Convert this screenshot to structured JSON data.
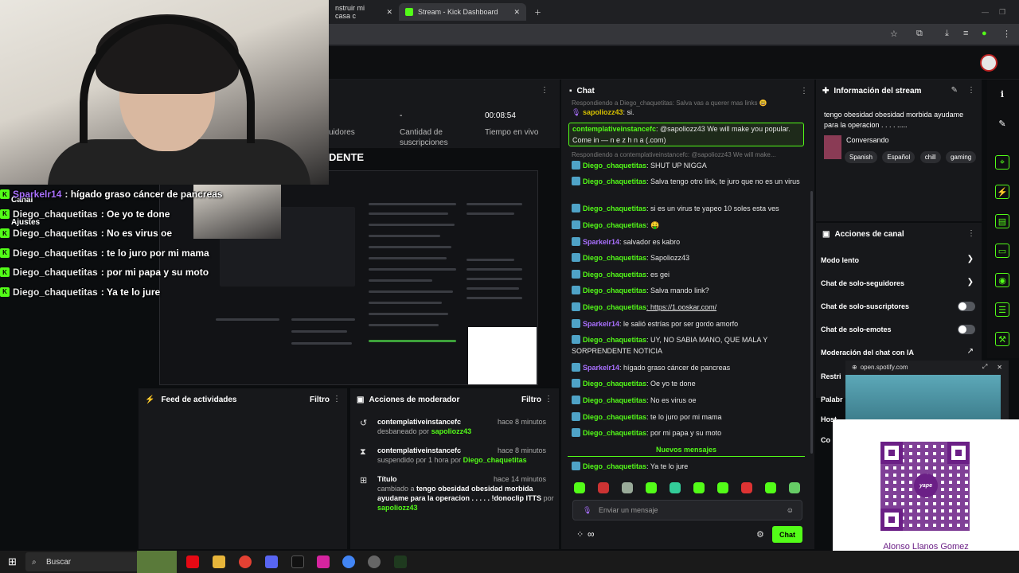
{
  "browser": {
    "tabs": [
      {
        "label": "nstruir mi casa c"
      },
      {
        "label": "Stream - Kick Dashboard"
      }
    ]
  },
  "stats": [
    {
      "value": "",
      "label": "uidores"
    },
    {
      "value": "-",
      "label": "Cantidad de suscripciones"
    },
    {
      "value": "00:08:54",
      "label": "Tiempo en vivo"
    }
  ],
  "stream_title_fragment": "DENTE",
  "overlay": {
    "canal": "Canal",
    "ajustes": "Ajustes",
    "messages": [
      {
        "user": "Sparkelr14",
        "text": ": hígado graso cáncer de pancreas",
        "color": "purple"
      },
      {
        "user": "Diego_chaquetitas",
        "text": ": Oe yo te done",
        "color": "white"
      },
      {
        "user": "Diego_chaquetitas",
        "text": ": No es virus oe",
        "color": "white"
      },
      {
        "user": "Diego_chaquetitas",
        "text": ": te lo juro por mi mama",
        "color": "white"
      },
      {
        "user": "Diego_chaquetitas",
        "text": ": por mi papa y su moto",
        "color": "white"
      },
      {
        "user": "Diego_chaquetitas",
        "text": ": Ya te lo jure",
        "color": "white"
      }
    ]
  },
  "activity_feed": {
    "title": "Feed de actividades",
    "filter": "Filtro"
  },
  "mod_actions": {
    "title": "Acciones de moderador",
    "filter": "Filtro",
    "items": [
      {
        "icon": "undo-icon",
        "name": "contemplativeinstancefc",
        "time": "hace 8 minutos",
        "action": "desbaneado por",
        "by": "sapoliozz43"
      },
      {
        "icon": "hourglass-icon",
        "name": "contemplativeinstancefc",
        "time": "hace 8 minutos",
        "action": "suspendido por 1 hora por",
        "by": "Diego_chaquetitas"
      },
      {
        "icon": "title-icon",
        "name": "Título",
        "time": "hace 14 minutos",
        "action": "cambiado a",
        "detail": "tengo obesidad obesidad morbida ayudame para la operacion . . . . . !donoclip ITTS",
        "joiner": "por",
        "by": "sapoliozz43"
      }
    ]
  },
  "chat": {
    "title": "Chat",
    "reply_ctx_1": "Respondiendo a Diego_chaquetitas: Salva vas a querer mas links 😃",
    "first_msg": {
      "user": "sapoliozz43",
      "text": ": si."
    },
    "highlight": {
      "user": "contemplativeinstancefc",
      "text": ": @sapoliozz43 We will make you popular. Come in — n e z h n a (.com)"
    },
    "reply_ctx_2": "Respondiendo a contemplativeinstancefc: @sapoliozz43 We will make...",
    "messages": [
      {
        "user": "Diego_chaquetitas",
        "text": ": SHUT UP NIGGA",
        "color": "green"
      },
      {
        "user": "Diego_chaquetitas",
        "text": ": Salva tengo otro link, te juro que no es un virus",
        "color": "green"
      },
      {
        "user": "Diego_chaquetitas",
        "text": ": si es un virus te yapeo 10 soles esta ves",
        "color": "green"
      },
      {
        "user": "Diego_chaquetitas",
        "text": ": 🤑",
        "color": "green"
      },
      {
        "user": "Sparkelr14",
        "text": ": salvador es kabro",
        "color": "purple"
      },
      {
        "user": "Diego_chaquetitas",
        "text": ": Sapoliozz43",
        "color": "green"
      },
      {
        "user": "Diego_chaquetitas",
        "text": ": es gei",
        "color": "green"
      },
      {
        "user": "Diego_chaquetitas",
        "text": ": Salva mando link?",
        "color": "green"
      },
      {
        "user": "Diego_chaquetitas",
        "text": ": https://1.ooskar.com/",
        "color": "green"
      },
      {
        "user": "Sparkelr14",
        "text": ": le salió estrías por ser gordo amorfo",
        "color": "purple"
      },
      {
        "user": "Diego_chaquetitas",
        "text": ": UY, NO SABIA MANO, QUE MALA Y SORPRENDENTE NOTICIA",
        "color": "green"
      },
      {
        "user": "Sparkelr14",
        "text": ": hígado graso cáncer de pancreas",
        "color": "purple"
      },
      {
        "user": "Diego_chaquetitas",
        "text": ": Oe yo te done",
        "color": "green"
      },
      {
        "user": "Diego_chaquetitas",
        "text": ": No es virus oe",
        "color": "green"
      },
      {
        "user": "Diego_chaquetitas",
        "text": ": te lo juro por mi mama",
        "color": "green"
      },
      {
        "user": "Diego_chaquetitas",
        "text": ": por mi papa y su moto",
        "color": "green"
      }
    ],
    "new_messages": "Nuevos mensajes",
    "last_msg": {
      "user": "Diego_chaquetitas",
      "text": ": Ya te lo jure"
    },
    "input_placeholder": "Enviar un mensaje",
    "send_label": "Chat",
    "points": "∞"
  },
  "stream_info": {
    "title": "Información del stream",
    "stream_title": "tengo obesidad obesidad morbida ayudame para la operacion . . . . .....",
    "category": "Conversando",
    "tags": [
      "Spanish",
      "Español",
      "chill",
      "gaming"
    ]
  },
  "channel_actions": {
    "title": "Acciones de canal",
    "items": [
      {
        "label": "Modo lento",
        "control": "chevron"
      },
      {
        "label": "Chat de solo-seguidores",
        "control": "chevron"
      },
      {
        "label": "Chat de solo-suscriptores",
        "control": "toggle"
      },
      {
        "label": "Chat de solo-emotes",
        "control": "toggle"
      },
      {
        "label": "Moderación del chat con IA",
        "control": "external"
      }
    ],
    "truncated": [
      "Restri",
      "Palabr",
      "Host",
      "Co"
    ]
  },
  "spotify": {
    "url": "open.spotify.com"
  },
  "qr": {
    "name": "Alonso Llanos Gomez",
    "brand": "yape"
  },
  "taskbar": {
    "search": "Buscar"
  }
}
